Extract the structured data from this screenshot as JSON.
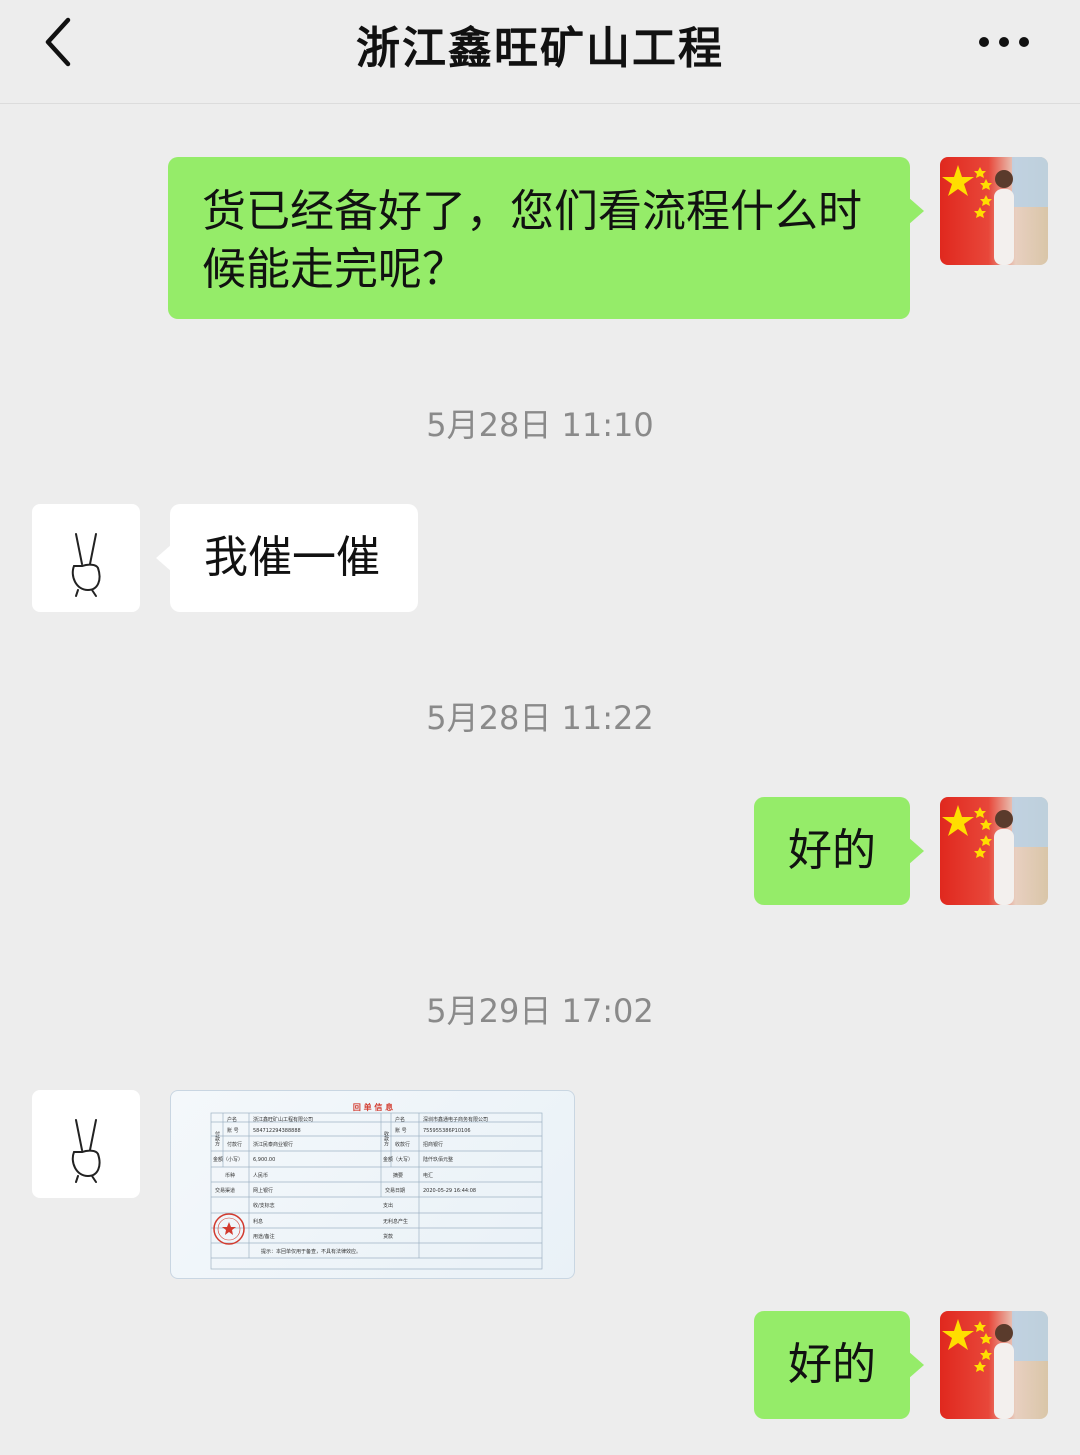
{
  "header": {
    "title": "浙江鑫旺矿山工程",
    "back_icon": "chevron-left-icon",
    "more_icon": "more-dots-icon"
  },
  "messages": [
    {
      "sender": "me",
      "type": "text",
      "lines": [
        "货已经备好了，您们看流程什么时",
        "候能走完呢？"
      ]
    },
    {
      "type": "timestamp",
      "text": "5月28日 11:10"
    },
    {
      "sender": "other",
      "type": "text",
      "text": "我催一催"
    },
    {
      "type": "timestamp",
      "text": "5月28日 11:22"
    },
    {
      "sender": "me",
      "type": "text",
      "text": "好的"
    },
    {
      "type": "timestamp",
      "text": "5月29日 17:02"
    },
    {
      "sender": "other",
      "type": "image",
      "receipt": {
        "title": "回 单 信 息",
        "payer_label": "付款方",
        "payee_label": "收款方",
        "rows": [
          {
            "l1": "户名",
            "v1": "浙江鑫旺矿山工程有限公司",
            "l2": "户名",
            "v2": "深圳市鑫通电子商务有限公司"
          },
          {
            "l1": "账 号",
            "v1": "584712294388888",
            "l2": "账 号",
            "v2": "755955386P10106"
          },
          {
            "l1": "付款行",
            "v1": "浙江民泰商业银行",
            "l2": "收款行",
            "v2": "招商银行"
          },
          {
            "l1": "金额（小写）",
            "v1": "6,900.00",
            "l2": "金额（大写）",
            "v2": "陆仟玖佰元整"
          },
          {
            "l1": "币种",
            "v1": "人民币",
            "l2": "摘要",
            "v2": "电汇"
          },
          {
            "l1": "交易渠道",
            "v1": "网上银行",
            "l2": "交易日期",
            "v2": "2020-05-29 16:44:08"
          },
          {
            "l1": "收/支标志",
            "v1": "支出"
          },
          {
            "l1": "利息",
            "v1": "无利息产生"
          },
          {
            "l1": "用途/备注",
            "v1": "货款"
          }
        ],
        "note": "提示：本回单仅用于备查，不具有法律效应。"
      }
    },
    {
      "sender": "me",
      "type": "text",
      "text": "好的"
    }
  ],
  "colors": {
    "my_bubble": "#95ec69",
    "other_bubble": "#ffffff",
    "background": "#ededed",
    "timestamp": "#8a8a8a",
    "stamp": "#d23a2e"
  },
  "icons": {
    "my_avatar": "china-flag-avatar-icon",
    "other_avatar": "peace-hand-avatar-icon",
    "stamp": "red-seal-stamp-icon"
  }
}
